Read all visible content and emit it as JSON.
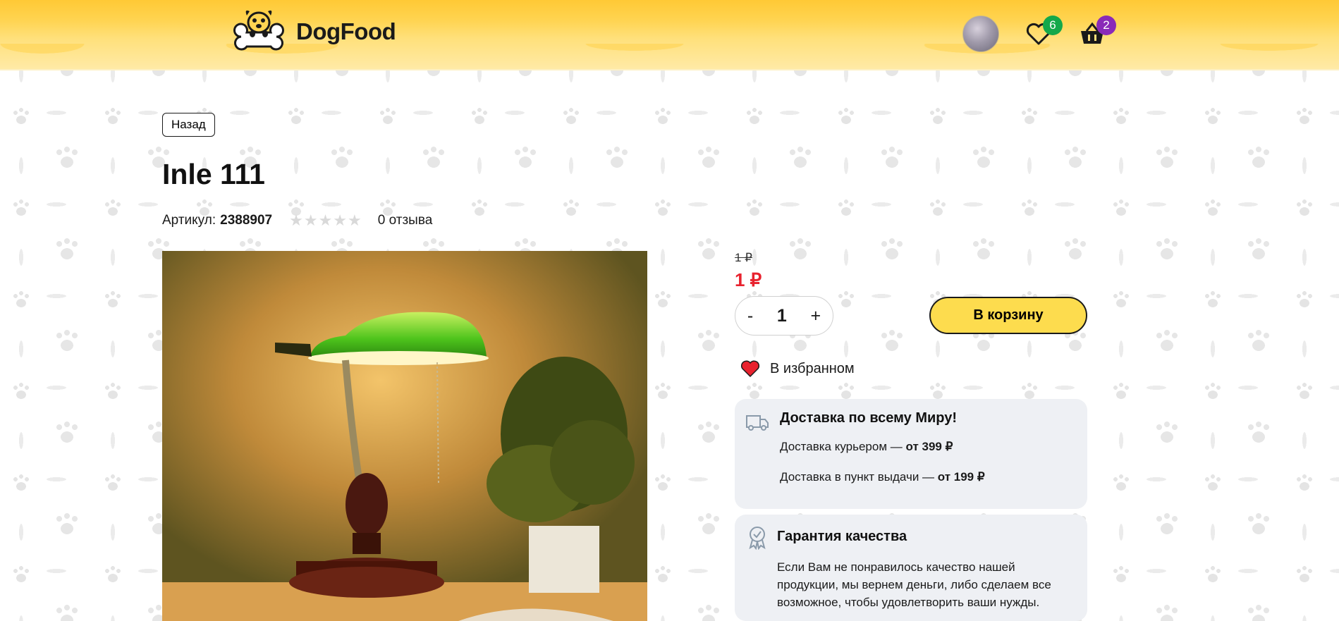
{
  "header": {
    "logo_text": "DogFood",
    "favorites_count": "6",
    "cart_count": "2"
  },
  "product": {
    "back_label": "Назад",
    "title": "Inle 111",
    "article_label": "Артикул:",
    "article_value": "2388907",
    "rating": 0,
    "rating_max": 5,
    "reviews": "0 отзыва",
    "old_price": "1 ₽",
    "price": "1 ₽",
    "quantity": "1",
    "qty_minus": "-",
    "qty_plus": "+",
    "add_to_cart": "В корзину",
    "favorite_label": "В избранном"
  },
  "delivery": {
    "title": "Доставка по всему Миру!",
    "courier_label": "Доставка курьером — ",
    "courier_price": "от 399 ₽",
    "pickup_label": "Доставка в пункт выдачи — ",
    "pickup_price": "от 199 ₽"
  },
  "guarantee": {
    "title": "Гарантия качества",
    "text": "Если Вам не понравилось качество нашей продукции, мы вернем деньги, либо сделаем все возможное, чтобы удовлетворить ваши нужды."
  },
  "colors": {
    "header": "#ffd452",
    "price_red": "#e8222e",
    "button_yellow": "#fddc4e",
    "panel_bg": "#eef0f4"
  }
}
